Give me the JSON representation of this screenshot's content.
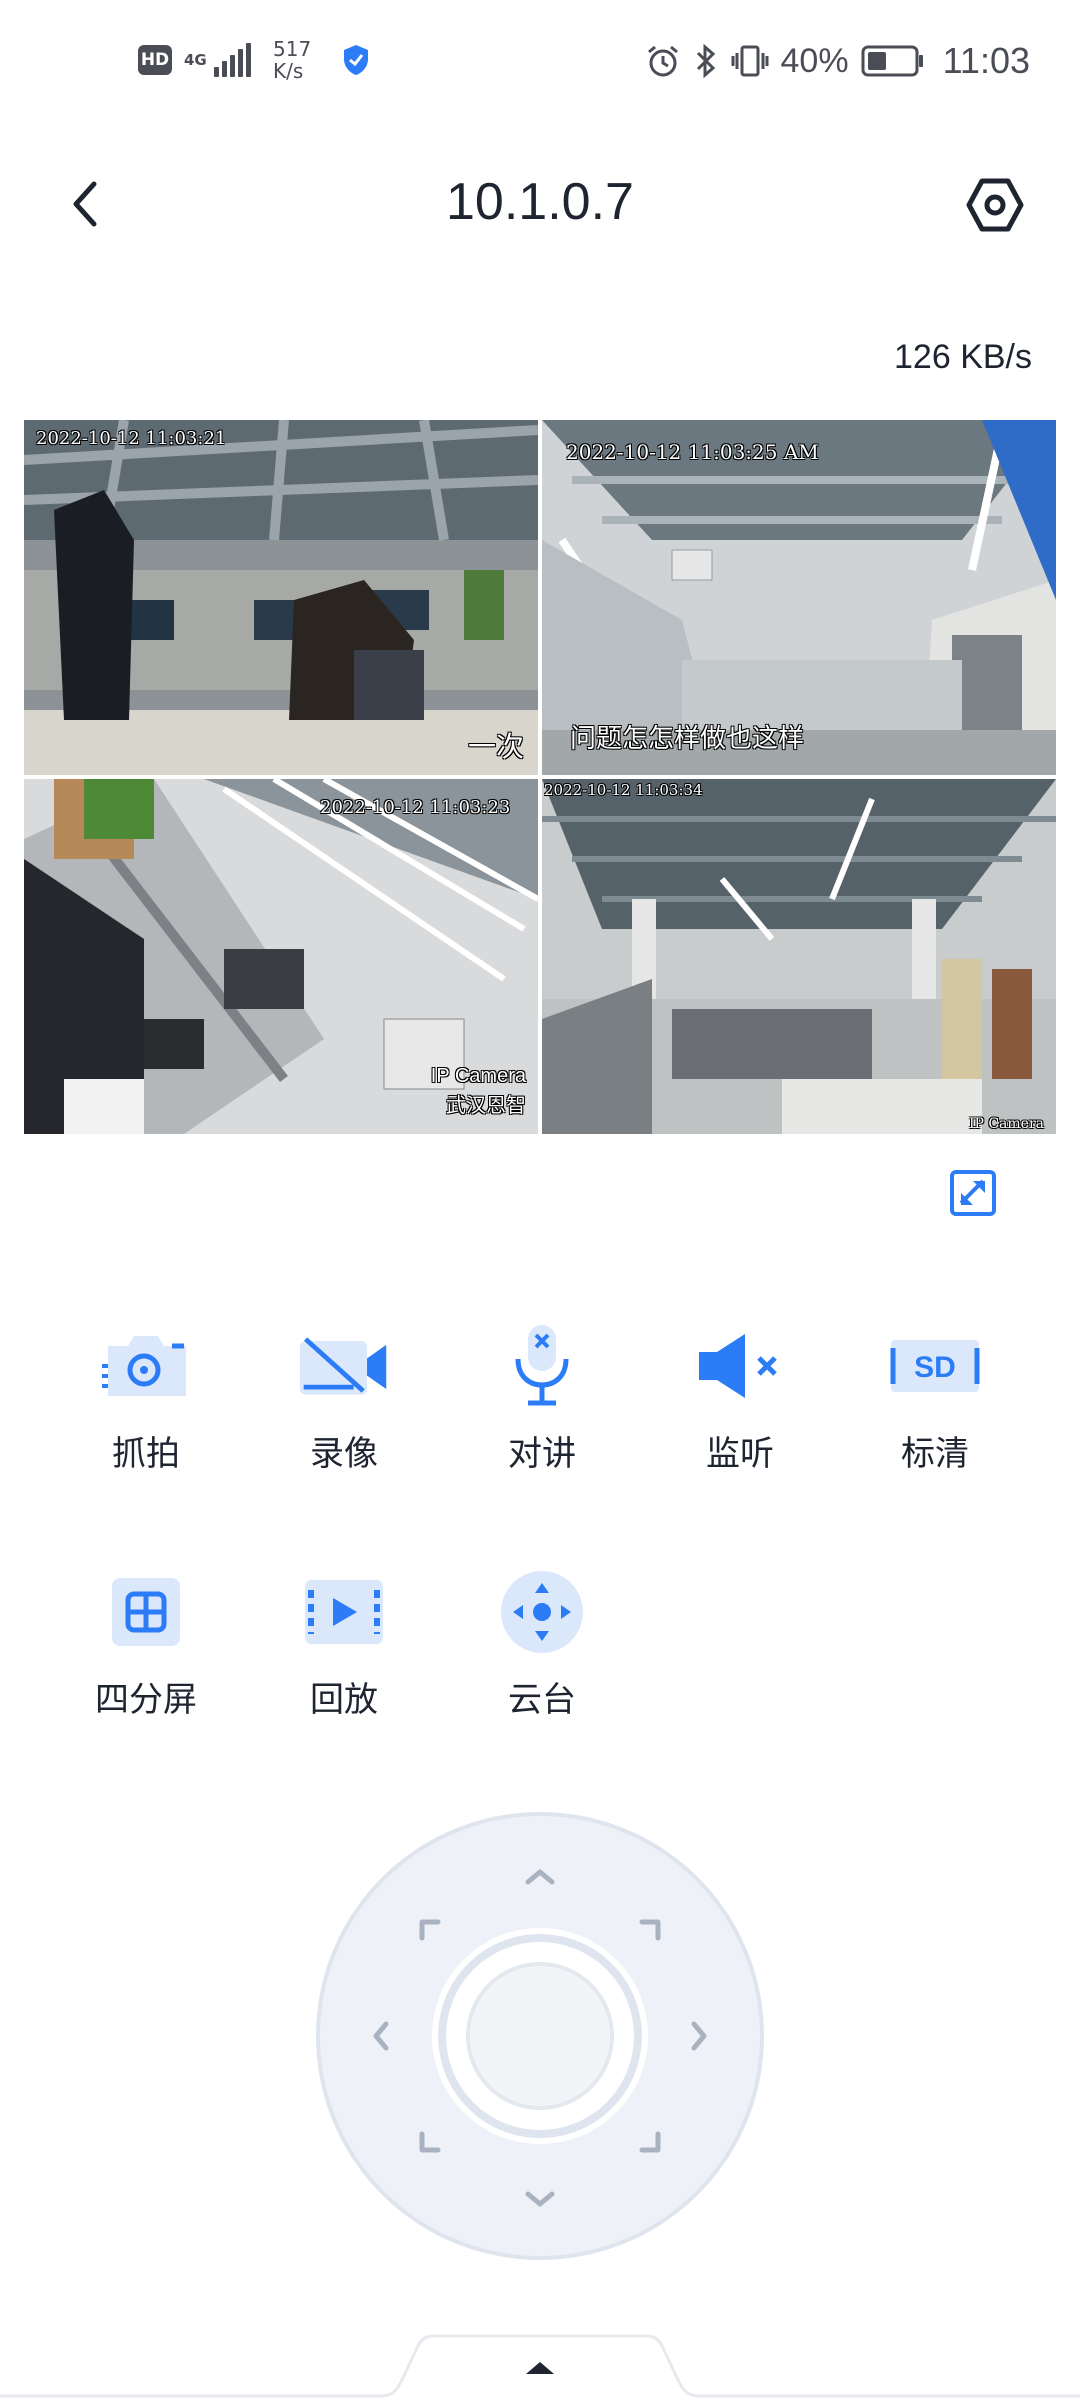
{
  "status_bar": {
    "hd": "HD",
    "network_type": "4G",
    "net_speed_value": "517",
    "net_speed_unit": "K/s",
    "battery_percent": "40%",
    "time": "11:03"
  },
  "header": {
    "title": "10.1.0.7"
  },
  "speed_indicator": "126 KB/s",
  "cameras": [
    {
      "timestamp": "2022-10-12 11:03:21",
      "caption": "一次"
    },
    {
      "timestamp": "2022-10-12 11:03:25 AM",
      "caption": "问题怎怎样做也这样"
    },
    {
      "timestamp": "2022-10-12 11:03:23",
      "caption_line1": "IP Camera",
      "caption_line2": "武汉恩智"
    },
    {
      "timestamp": "2022-10-12 11:03:34",
      "caption": "IP Camera"
    }
  ],
  "actions": [
    {
      "label": "抓拍",
      "icon": "snapshot-camera-icon"
    },
    {
      "label": "录像",
      "icon": "record-video-off-icon"
    },
    {
      "label": "对讲",
      "icon": "talk-mic-muted-icon"
    },
    {
      "label": "监听",
      "icon": "listen-speaker-muted-icon"
    },
    {
      "label": "标清",
      "icon": "sd-quality-icon"
    },
    {
      "label": "四分屏",
      "icon": "quad-split-icon"
    },
    {
      "label": "回放",
      "icon": "playback-icon"
    },
    {
      "label": "云台",
      "icon": "ptz-icon"
    }
  ],
  "colors": {
    "accent": "#2b7cf6",
    "accent_light": "#dbe8fb",
    "selected_border": "#e02a3a",
    "text": "#1e2430",
    "ptz_ring": "#e8edf5"
  }
}
